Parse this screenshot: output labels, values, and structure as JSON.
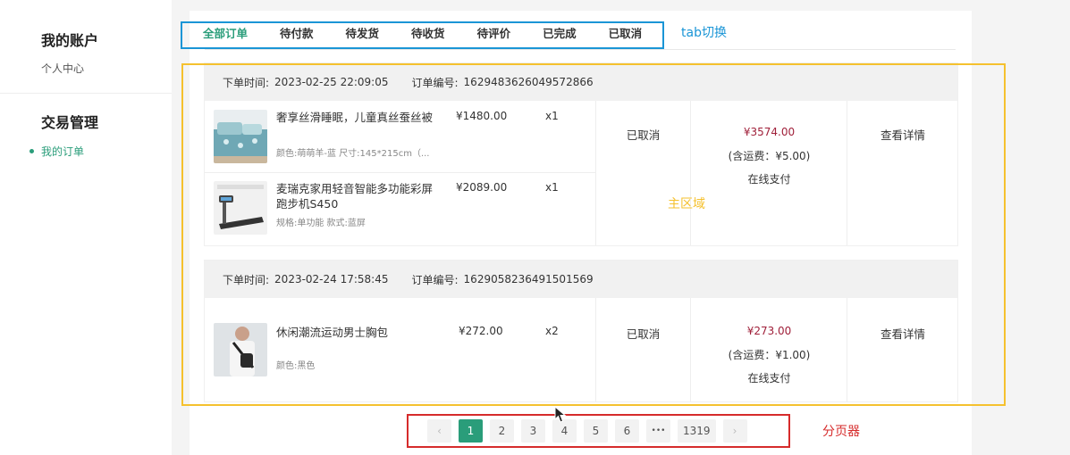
{
  "sidebar": {
    "section1_title": "我的账户",
    "section1_item": "个人中心",
    "section2_title": "交易管理",
    "section2_item": "我的订单"
  },
  "tabs": [
    "全部订单",
    "待付款",
    "待发货",
    "待收货",
    "待评价",
    "已完成",
    "已取消"
  ],
  "orders": [
    {
      "time_label": "下单时间:",
      "time": "2023-02-25 22:09:05",
      "no_label": "订单编号:",
      "no": "1629483626049572866",
      "items": [
        {
          "name": "奢享丝滑睡眠，儿童真丝蚕丝被",
          "spec": "颜色:萌萌羊-蓝 尺寸:145*215cm（...",
          "price": "¥1480.00",
          "qty": "x1",
          "image": "bedding-product-image"
        },
        {
          "name": "麦瑞克家用轻音智能多功能彩屏跑步机S450",
          "spec": "规格:单功能 款式:蓝屏",
          "price": "¥2089.00",
          "qty": "x1",
          "image": "treadmill-product-image"
        }
      ],
      "status": "已取消",
      "total": "¥3574.00",
      "shipping": "(含运费：¥5.00)",
      "payment": "在线支付",
      "action": "查看详情"
    },
    {
      "time_label": "下单时间:",
      "time": "2023-02-24 17:58:45",
      "no_label": "订单编号:",
      "no": "1629058236491501569",
      "items": [
        {
          "name": "休闲潮流运动男士胸包",
          "spec": "颜色:黑色",
          "price": "¥272.00",
          "qty": "x2",
          "image": "chest-bag-product-image"
        }
      ],
      "status": "已取消",
      "total": "¥273.00",
      "shipping": "(含运费：¥1.00)",
      "payment": "在线支付",
      "action": "查看详情"
    }
  ],
  "pagination": {
    "prev": "‹",
    "pages": [
      "1",
      "2",
      "3",
      "4",
      "5",
      "6",
      "•••",
      "1319"
    ],
    "current": "1",
    "next": "›"
  },
  "annotations": {
    "tab_label": "tab切换",
    "main_label": "主区域",
    "pager_label": "分页器",
    "tab_color": "#1a95d6",
    "main_color": "#f5c12e",
    "pager_color": "#d62b2b"
  },
  "accent_color": "#2a9d7a",
  "price_color": "#a0203a"
}
